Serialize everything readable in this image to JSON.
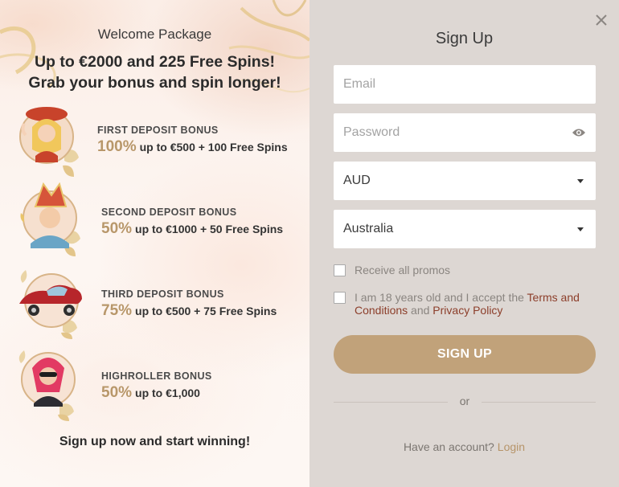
{
  "promo": {
    "welcome": "Welcome Package",
    "headline_1": "Up to €2000 and 225 Free Spins!",
    "headline_2": "Grab your bonus and spin longer!",
    "bonuses": [
      {
        "label": "FIRST DEPOSIT BONUS",
        "percent": "100%",
        "detail": "up to €500 + 100 Free Spins",
        "icon": "woman-hat-avatar-icon"
      },
      {
        "label": "SECOND DEPOSIT BONUS",
        "percent": "50%",
        "detail": "up to €1000 + 50 Free Spins",
        "icon": "bishop-avatar-icon"
      },
      {
        "label": "THIRD DEPOSIT BONUS",
        "percent": "75%",
        "detail": "up to €500 + 75 Free Spins",
        "icon": "red-car-icon"
      },
      {
        "label": "HIGHROLLER BONUS",
        "percent": "50%",
        "detail": "up to €1,000",
        "icon": "masked-woman-avatar-icon"
      }
    ],
    "cta": "Sign up now and start winning!"
  },
  "form": {
    "close_icon": "close-icon",
    "title": "Sign Up",
    "email_placeholder": "Email",
    "password_placeholder": "Password",
    "password_icon": "eye-icon",
    "currency_value": "AUD",
    "country_value": "Australia",
    "promos_label": "Receive all promos",
    "terms_prefix": "I am 18 years old and I accept the ",
    "terms_link": "Terms and Conditions",
    "terms_and": " and ",
    "privacy_link": "Privacy Policy",
    "signup_label": "SIGN UP",
    "or_label": "or",
    "have_account": "Have an account?",
    "login_label": "Login"
  },
  "colors": {
    "accent_gold": "#c1a27a",
    "percent_gold": "#b8976a",
    "link_red": "#8c3e2a",
    "right_panel_bg": "#ddd7d3"
  }
}
